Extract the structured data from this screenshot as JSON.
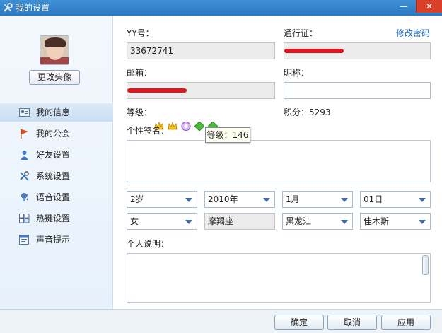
{
  "window": {
    "title": "我的设置",
    "minimize_glyph": "—",
    "close_glyph": "✕"
  },
  "sidebar": {
    "change_avatar_label": "更改头像",
    "items": [
      {
        "label": "我的信息",
        "icon": "user-card-icon",
        "active": true
      },
      {
        "label": "我的公会",
        "icon": "flag-icon",
        "active": false
      },
      {
        "label": "好友设置",
        "icon": "friend-icon",
        "active": false
      },
      {
        "label": "系统设置",
        "icon": "tools-icon",
        "active": false
      },
      {
        "label": "语音设置",
        "icon": "voice-icon",
        "active": false
      },
      {
        "label": "热键设置",
        "icon": "hotkey-icon",
        "active": false
      },
      {
        "label": "声音提示",
        "icon": "sound-notice-icon",
        "active": false
      }
    ]
  },
  "profile": {
    "yy_label": "YY号：",
    "yy_value": "33672741",
    "passport_label": "通行证：",
    "change_password_label": "修改密码",
    "email_label": "邮箱：",
    "nickname_label": "昵称：",
    "nickname_value": "",
    "level_label": "等级：",
    "level_tooltip": "等级：146",
    "points_label": "积分：5293",
    "signature_label": "个性签名：",
    "signature_value": "",
    "age_value": "2岁",
    "year_value": "2010年",
    "month_value": "1月",
    "day_value": "01日",
    "gender_value": "女",
    "zodiac_value": "摩羯座",
    "province_value": "黑龙江",
    "city_value": "佳木斯",
    "description_label": "个人说明：",
    "description_value": ""
  },
  "footer": {
    "ok_label": "确定",
    "cancel_label": "取消",
    "apply_label": "应用"
  },
  "colors": {
    "titlebar": "#2f82cc",
    "redaction": "#e0161f",
    "link": "#1a66b8",
    "close": "#d8402a"
  }
}
